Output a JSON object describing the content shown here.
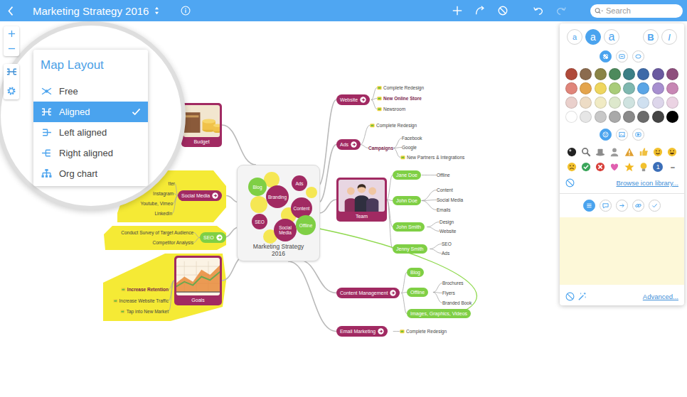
{
  "topbar": {
    "title": "Marketing Strategy 2016",
    "search_placeholder": "Search",
    "actions": [
      {
        "kind": "add",
        "disabled": false
      },
      {
        "kind": "relation",
        "disabled": false
      },
      {
        "kind": "clear",
        "disabled": false
      },
      {
        "kind": "undo",
        "disabled": false
      },
      {
        "kind": "redo",
        "disabled": true
      }
    ]
  },
  "layout_menu": {
    "title": "Map Layout",
    "items": [
      {
        "label": "Free",
        "kind": "free",
        "selected": false
      },
      {
        "label": "Aligned",
        "kind": "aligned",
        "selected": true
      },
      {
        "label": "Left aligned",
        "kind": "left",
        "selected": false
      },
      {
        "label": "Right aligned",
        "kind": "right",
        "selected": false
      },
      {
        "label": "Org chart",
        "kind": "org",
        "selected": false
      }
    ]
  },
  "map": {
    "center": {
      "title": "Marketing Strategy 2016",
      "bubbles": [
        {
          "label": "Blog",
          "color": "#7fcf45"
        },
        {
          "label": "Ads",
          "color": "#a12a62"
        },
        {
          "label": "Branding",
          "color": "#a12a62"
        },
        {
          "label": "Content",
          "color": "#a12a62"
        },
        {
          "label": "SEO",
          "color": "#a12a62"
        },
        {
          "label": "Social Media",
          "color": "#a12a62"
        },
        {
          "label": "Offline",
          "color": "#7fcf45"
        }
      ]
    },
    "branches": [
      {
        "label": "Website",
        "kind": "pill",
        "color": "#a12a62",
        "highlight": false,
        "children": [
          {
            "label": "Complete Redesign",
            "kind": "text",
            "bold": false,
            "note": true
          },
          {
            "label": "New Online Store",
            "kind": "text",
            "bold": true,
            "note": true
          },
          {
            "label": "Newsroom",
            "kind": "text",
            "bold": false,
            "note": true
          }
        ]
      },
      {
        "label": "Ads",
        "kind": "pill",
        "color": "#a12a62",
        "highlight": false,
        "children": [
          {
            "label": "Complete Redesign",
            "kind": "text",
            "bold": false,
            "note": true
          },
          {
            "label": "Campaigns",
            "kind": "text",
            "bold": true,
            "note": false,
            "children": [
              {
                "label": "Facebook",
                "kind": "text",
                "bold": false,
                "note": false
              },
              {
                "label": "Google",
                "kind": "text",
                "bold": false,
                "note": false
              },
              {
                "label": "New Partners & Integrations",
                "kind": "text",
                "bold": false,
                "note": true
              }
            ]
          }
        ]
      },
      {
        "label": "Team",
        "kind": "image",
        "color": "#a12a62",
        "highlight": false,
        "children": [
          {
            "label": "Jane Doe",
            "kind": "pill",
            "color": "#7fcf45",
            "children": [
              {
                "label": "Offline",
                "kind": "text",
                "bold": false,
                "note": false
              }
            ]
          },
          {
            "label": "John Doe",
            "kind": "pill",
            "color": "#7fcf45",
            "children": [
              {
                "label": "Content",
                "kind": "text",
                "bold": false,
                "note": false
              },
              {
                "label": "Social Media",
                "kind": "text",
                "bold": false,
                "note": false
              },
              {
                "label": "Emails",
                "kind": "text",
                "bold": false,
                "note": false
              }
            ]
          },
          {
            "label": "John Smith",
            "kind": "pill",
            "color": "#7fcf45",
            "children": [
              {
                "label": "Design",
                "kind": "text",
                "bold": false,
                "note": false
              },
              {
                "label": "Website",
                "kind": "text",
                "bold": false,
                "note": false
              }
            ]
          },
          {
            "label": "Jenny Smith",
            "kind": "pill",
            "color": "#7fcf45",
            "children": [
              {
                "label": "SEO",
                "kind": "text",
                "bold": false,
                "note": false
              },
              {
                "label": "Ads",
                "kind": "text",
                "bold": false,
                "note": false
              }
            ]
          }
        ]
      },
      {
        "label": "Content Management",
        "kind": "pill",
        "color": "#a12a62",
        "highlight": false,
        "children": [
          {
            "label": "Blog",
            "kind": "pill",
            "color": "#7fcf45"
          },
          {
            "label": "Offline",
            "kind": "pill",
            "color": "#7fcf45",
            "children": [
              {
                "label": "Brochures",
                "kind": "text",
                "bold": false,
                "note": false
              },
              {
                "label": "Flyers",
                "kind": "text",
                "bold": false,
                "note": false
              },
              {
                "label": "Branded Book",
                "kind": "text",
                "bold": false,
                "note": false
              }
            ]
          },
          {
            "label": "Images, Graphics, Videos",
            "kind": "pill",
            "color": "#7fcf45"
          }
        ]
      },
      {
        "label": "Email Marketing",
        "kind": "pill",
        "color": "#a12a62",
        "highlight": false,
        "children": [
          {
            "label": "Complete Redesign",
            "kind": "text",
            "bold": false,
            "note": true
          }
        ]
      },
      {
        "label": "Budget",
        "kind": "image",
        "color": "#a12a62",
        "highlight": false,
        "children": []
      },
      {
        "label": "Social Media",
        "kind": "pill",
        "color": "#a12a62",
        "highlight": true,
        "children": [
          {
            "label": "tter",
            "kind": "text",
            "bold": false,
            "note": false
          },
          {
            "label": "Instagram",
            "kind": "text",
            "bold": false,
            "note": false
          },
          {
            "label": "Youtube, Vimeo",
            "kind": "text",
            "bold": false,
            "note": false
          },
          {
            "label": "LinkedIn",
            "kind": "text",
            "bold": false,
            "note": false
          }
        ]
      },
      {
        "label": "SEO",
        "kind": "pill",
        "color": "#7fcf45",
        "highlight": true,
        "children": [
          {
            "label": "Conduct Survey of Target Audience",
            "kind": "text",
            "bold": false,
            "note": false
          },
          {
            "label": "Competitor Analysis",
            "kind": "text",
            "bold": false,
            "note": false
          }
        ]
      },
      {
        "label": "Goals",
        "kind": "image",
        "color": "#a12a62",
        "highlight": true,
        "children": [
          {
            "label": "Increase Retention",
            "kind": "text",
            "bold": true,
            "note": true
          },
          {
            "label": "Increase Website Traffic",
            "kind": "text",
            "bold": false,
            "note": true
          },
          {
            "label": "Tap into New Market",
            "kind": "text",
            "bold": false,
            "note": true
          }
        ]
      }
    ]
  },
  "format_panel": {
    "text_sizes": [
      {
        "label": "a",
        "selected": false
      },
      {
        "label": "a",
        "selected": true
      },
      {
        "label": "a",
        "selected": false
      }
    ],
    "styles": [
      {
        "label": "B",
        "kind": "bold"
      },
      {
        "label": "I",
        "kind": "italic"
      }
    ],
    "shape_tabs": [
      {
        "kind": "fill",
        "selected": true
      },
      {
        "kind": "border",
        "selected": false
      },
      {
        "kind": "shape",
        "selected": false
      }
    ],
    "swatches": [
      {
        "color": "#b04a3a"
      },
      {
        "color": "#8b6b4e"
      },
      {
        "color": "#8a8446"
      },
      {
        "color": "#4d8a5c"
      },
      {
        "color": "#3c7f86"
      },
      {
        "color": "#3e6aa8"
      },
      {
        "color": "#6a5aa0"
      },
      {
        "color": "#8e4f7d"
      },
      {
        "color": "#e0857a"
      },
      {
        "color": "#e4a44c"
      },
      {
        "color": "#efd65e"
      },
      {
        "color": "#a9cc79"
      },
      {
        "color": "#7fb8b0"
      },
      {
        "color": "#5aa5e6"
      },
      {
        "color": "#a78fd0"
      },
      {
        "color": "#c786b4"
      },
      {
        "color": "#ead0cc"
      },
      {
        "color": "#eddcc5"
      },
      {
        "color": "#f1ebc4"
      },
      {
        "color": "#dde8cc"
      },
      {
        "color": "#cfe3e0"
      },
      {
        "color": "#cfe0f0"
      },
      {
        "color": "#ddd6eb"
      },
      {
        "color": "#ebd3e3"
      },
      {
        "color": "#ffffff"
      },
      {
        "color": "#e6e6e6"
      },
      {
        "color": "#c8c8c8"
      },
      {
        "color": "#a9a9a9"
      },
      {
        "color": "#8a8a8a"
      },
      {
        "color": "#6b6b6b"
      },
      {
        "color": "#444444"
      },
      {
        "color": "#000000"
      }
    ],
    "media_tabs": [
      {
        "kind": "icon",
        "selected": true
      },
      {
        "kind": "image",
        "selected": false
      },
      {
        "kind": "video",
        "selected": false
      }
    ],
    "icons": [
      {
        "kind": "ball",
        "color": "#222222"
      },
      {
        "kind": "search",
        "color": "#777777"
      },
      {
        "kind": "hat",
        "color": "#8c8c8c"
      },
      {
        "kind": "person",
        "color": "#9a9a9a"
      },
      {
        "kind": "warning",
        "color": "#e0a030"
      },
      {
        "kind": "thumb",
        "color": "#f0c040"
      },
      {
        "kind": "smile",
        "color": "#f2c12e"
      },
      {
        "kind": "grin",
        "color": "#f2c12e"
      },
      {
        "kind": "frown",
        "color": "#f2c12e"
      },
      {
        "kind": "check",
        "color": "#3aa55a"
      },
      {
        "kind": "cross",
        "color": "#d8403a"
      },
      {
        "kind": "heart",
        "color": "#e060b0"
      },
      {
        "kind": "star",
        "color": "#f2b820"
      },
      {
        "kind": "bulb",
        "color": "#f2c12e"
      },
      {
        "kind": "number",
        "text": "1",
        "color": "#3b6eb8"
      },
      {
        "kind": "more",
        "text": "•••",
        "color": "#8a8a8a"
      }
    ],
    "browse_link": "Browse icon library...",
    "note_tabs": [
      {
        "kind": "notes",
        "selected": true
      },
      {
        "kind": "comment",
        "selected": false
      },
      {
        "kind": "arrow",
        "selected": false
      },
      {
        "kind": "link",
        "selected": false
      },
      {
        "kind": "task",
        "selected": false
      }
    ],
    "advanced_link": "Advanced..."
  }
}
